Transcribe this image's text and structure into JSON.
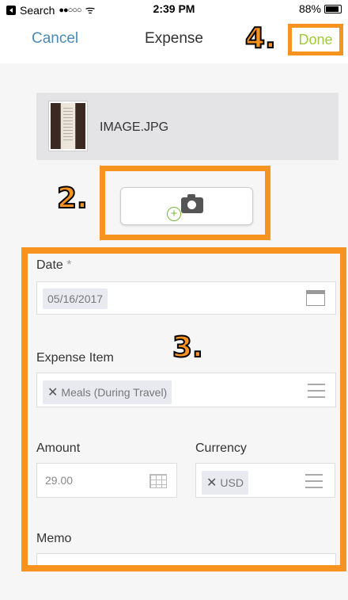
{
  "status_bar": {
    "back_label": "Search",
    "signal": "●●○○○",
    "wifi": "ᯤ",
    "time": "2:39 PM",
    "battery": "88%",
    "battery_level": 0.88
  },
  "nav": {
    "cancel": "Cancel",
    "title": "Expense",
    "done": "Done"
  },
  "annotations": {
    "done_step": "4.",
    "camera_step": "2.",
    "form_step": "3."
  },
  "attachment": {
    "file_name": "IMAGE.JPG"
  },
  "form": {
    "date": {
      "label": "Date",
      "required_mark": "*",
      "value": "05/16/2017"
    },
    "expense_item": {
      "label": "Expense Item",
      "value": "Meals (During Travel)",
      "remove": "✕"
    },
    "amount": {
      "label": "Amount",
      "value": "29.00"
    },
    "currency": {
      "label": "Currency",
      "value": "USD",
      "remove": "✕"
    },
    "memo": {
      "label": "Memo",
      "value": ""
    }
  },
  "colors": {
    "annotation": "#f7931e",
    "link": "#4a8ab8",
    "done": "#9ec93c"
  }
}
